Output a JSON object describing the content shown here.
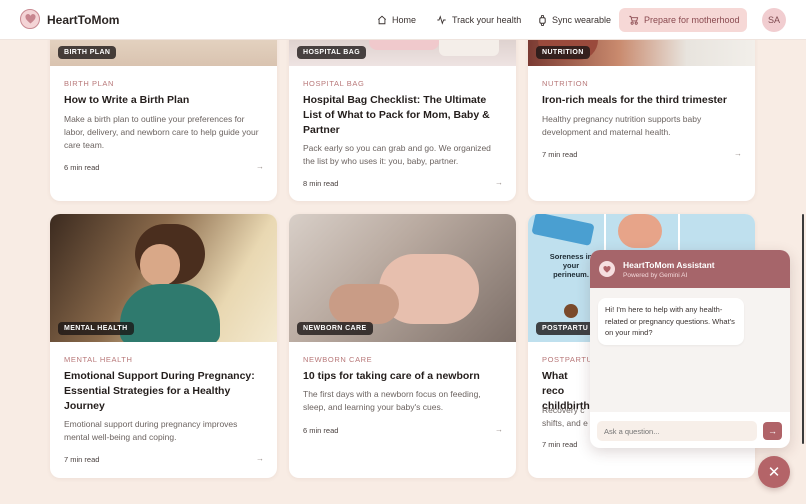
{
  "brand": {
    "name": "HeartToMom"
  },
  "nav": {
    "home": "Home",
    "track": "Track your health",
    "sync": "Sync wearable",
    "prepare": "Prepare for motherhood",
    "avatar": "SA"
  },
  "cards": [
    {
      "badge": "BIRTH PLAN",
      "category": "BIRTH PLAN",
      "title": "How to Write a Birth Plan",
      "desc": "Make a birth plan to outline your preferences for labor, delivery, and newborn care to help guide your care team.",
      "read": "6 min read",
      "arrow": "→"
    },
    {
      "badge": "HOSPITAL BAG",
      "category": "HOSPITAL BAG",
      "title": "Hospital Bag Checklist: The Ultimate List of What to Pack for Mom, Baby & Partner",
      "desc": "Pack early so you can grab and go. We organized the list by who uses it: you, baby, partner.",
      "read": "8 min read",
      "arrow": "→"
    },
    {
      "badge": "NUTRITION",
      "category": "NUTRITION",
      "title": "Iron-rich meals for the third trimester",
      "desc": "Healthy pregnancy nutrition supports baby development and maternal health.",
      "read": "7 min read",
      "arrow": "→"
    },
    {
      "badge": "MENTAL HEALTH",
      "category": "MENTAL HEALTH",
      "title": "Emotional Support During Pregnancy: Essential Strategies for a Healthy Journey",
      "desc": "Emotional support during pregnancy improves mental well-being and coping.",
      "read": "7 min read",
      "arrow": "→"
    },
    {
      "badge": "NEWBORN CARE",
      "category": "NEWBORN CARE",
      "title": "10 tips for taking care of a newborn",
      "desc": "The first days with a newborn focus on feeding, sleep, and learning your baby's cues.",
      "read": "6 min read",
      "arrow": "→"
    },
    {
      "badge": "POSTPARTU",
      "category": "POSTPARTU",
      "title": "What reco childbirth",
      "desc": "Recovery c shifts, and e",
      "read": "7 min read",
      "arrow": "→",
      "image_text": "Soreness in your perineum."
    }
  ],
  "chat": {
    "title": "HeartToMom Assistant",
    "subtitle": "Powered by Gemini AI",
    "message": "Hi! I'm here to help with any health-related or pregnancy questions. What's on your mind?",
    "placeholder": "Ask a question...",
    "send": "→",
    "close": "✕"
  },
  "colors": {
    "accent": "#b06368",
    "background": "#f8ece4",
    "category": "#b87879"
  }
}
